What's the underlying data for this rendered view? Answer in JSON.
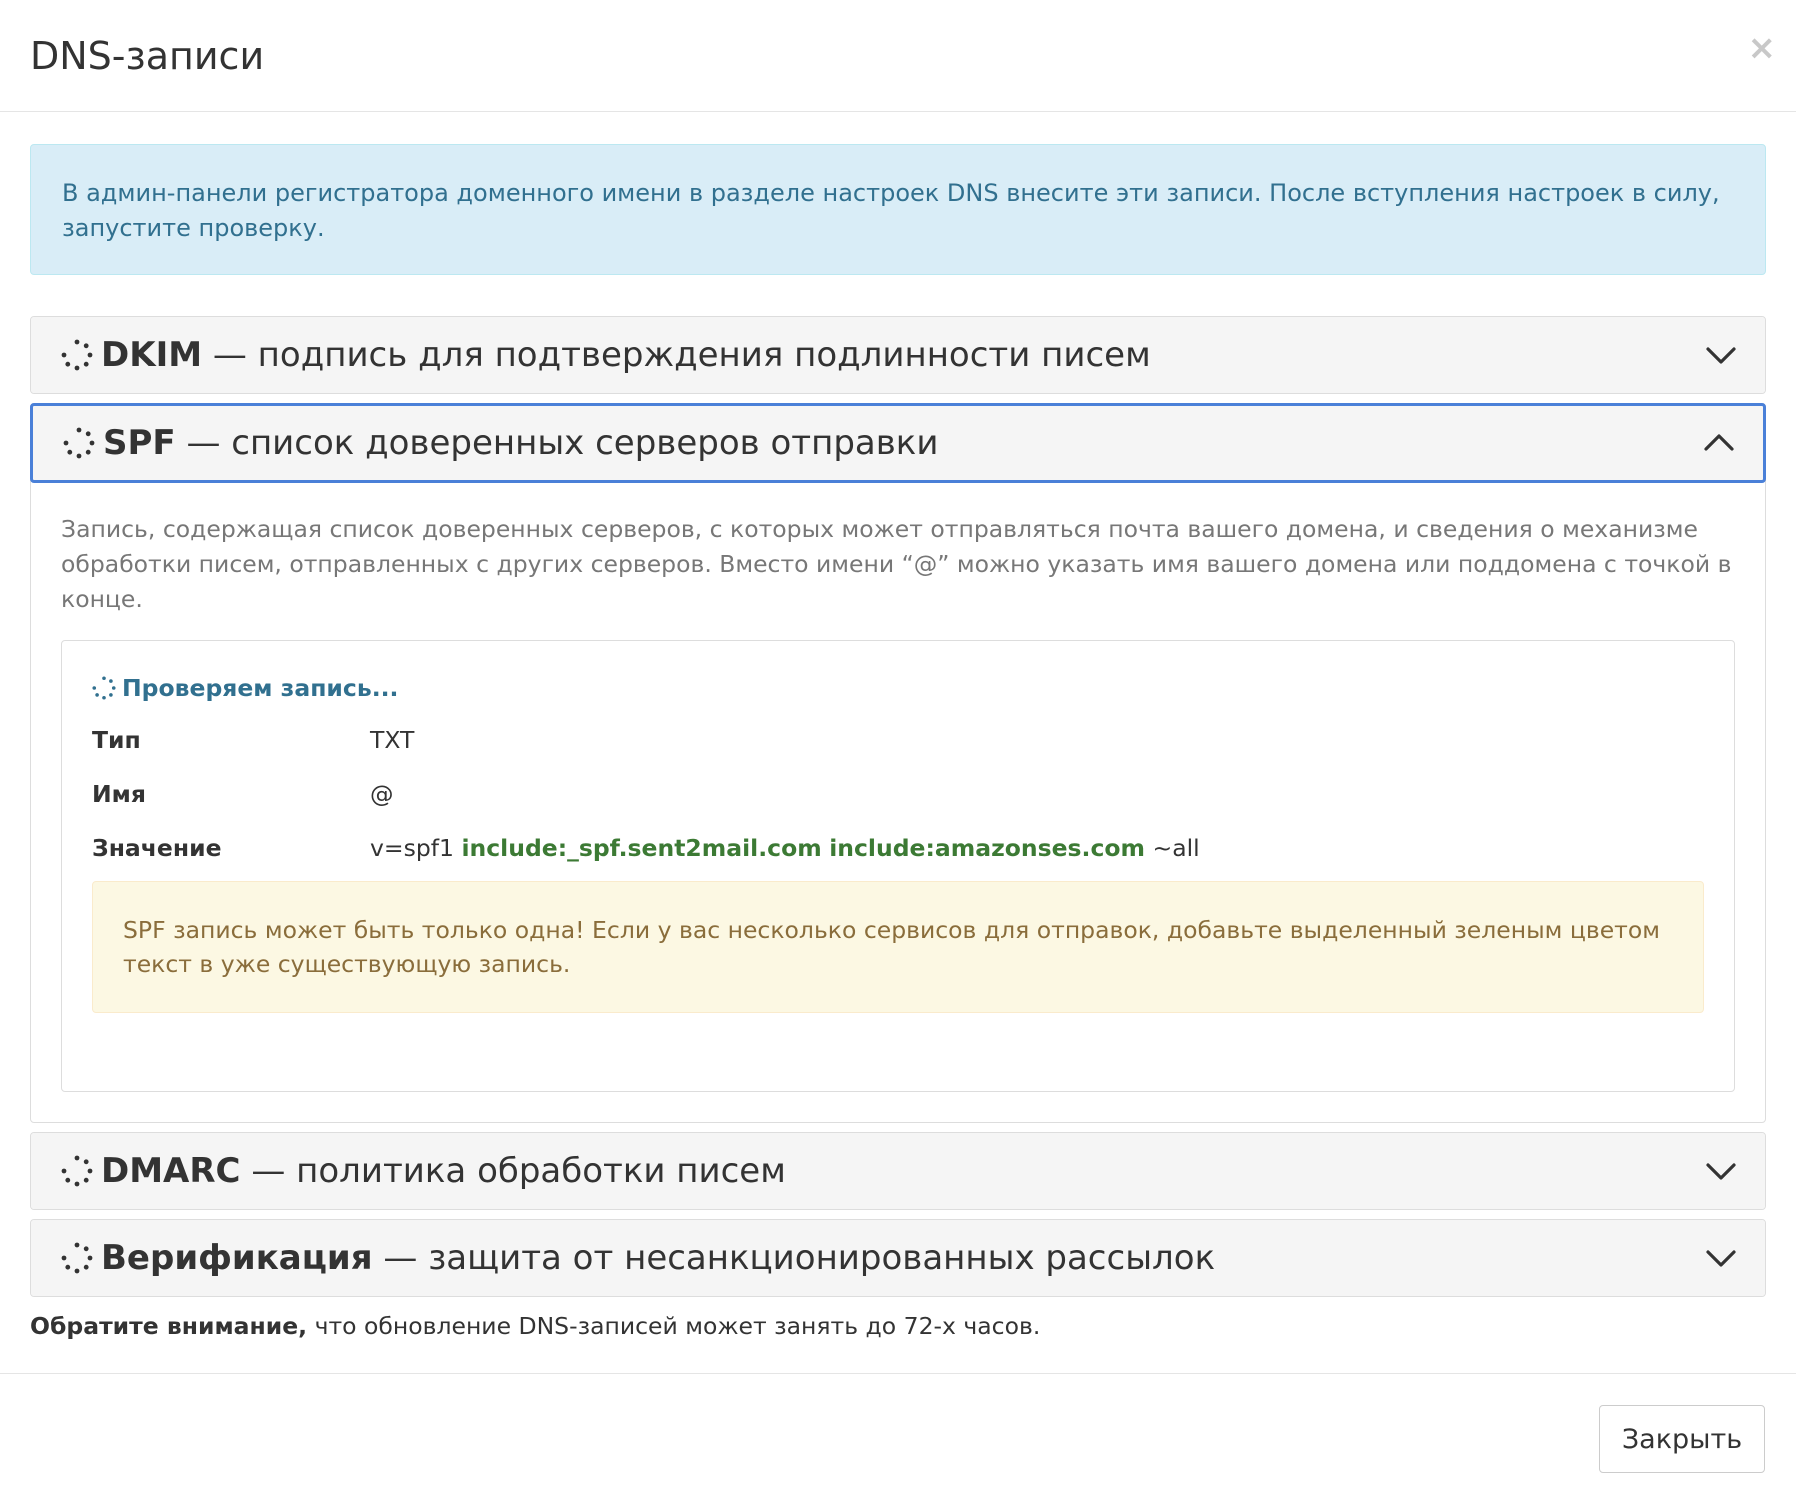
{
  "modal": {
    "title": "DNS-записи",
    "close_glyph": "×"
  },
  "info_alert": "В админ-панели регистратора доменного имени в разделе настроек DNS внесите эти записи. После вступления настроек в силу, запустите проверку.",
  "sections": {
    "dkim": {
      "name": "DKIM",
      "desc": " — подпись для подтверждения подлинности писем",
      "state": "collapsed"
    },
    "spf": {
      "name": "SPF",
      "desc": " — список доверенных серверов отправки",
      "state": "expanded",
      "body_text": "Запись, содержащая список доверенных серверов, с которых может отправляться почта вашего домена, и сведения о механизме обработки писем, отправленных с других серверов. Вместо имени “@” можно указать имя вашего домена или поддомена с точкой в конце.",
      "status": "Проверяем запись...",
      "rows": {
        "type_label": "Тип",
        "type_value": "TXT",
        "name_label": "Имя",
        "name_value": "@",
        "value_label": "Значение",
        "value_prefix": "v=spf1 ",
        "value_include1": "include:_spf.sent2mail.com",
        "value_include2": "include:amazonses.com",
        "value_suffix": " ~all"
      },
      "warning": "SPF запись может быть только одна! Если у вас несколько сервисов для отправок, добавьте выделенный зеленым цветом текст в уже существующую запись."
    },
    "dmarc": {
      "name": "DMARC",
      "desc": " — политика обработки писем",
      "state": "collapsed"
    },
    "verification": {
      "name": "Верификация",
      "desc": " — защита от несанкционированных рассылок",
      "state": "collapsed"
    }
  },
  "note": {
    "bold": "Обратите внимание,",
    "text": " что обновление DNS-записей может занять до 72-х часов."
  },
  "footer": {
    "close_button": "Закрыть"
  },
  "icons": {
    "spinner": "spinner-icon",
    "chevron_down": "chevron-down-icon",
    "chevron_up": "chevron-up-icon",
    "close": "close-icon"
  },
  "colors": {
    "info_bg": "#d9edf7",
    "info_text": "#31708f",
    "warn_bg": "#fcf8e3",
    "warn_text": "#8a6d3b",
    "highlight_green": "#3c7a34",
    "focus_border": "#4a80d8"
  }
}
